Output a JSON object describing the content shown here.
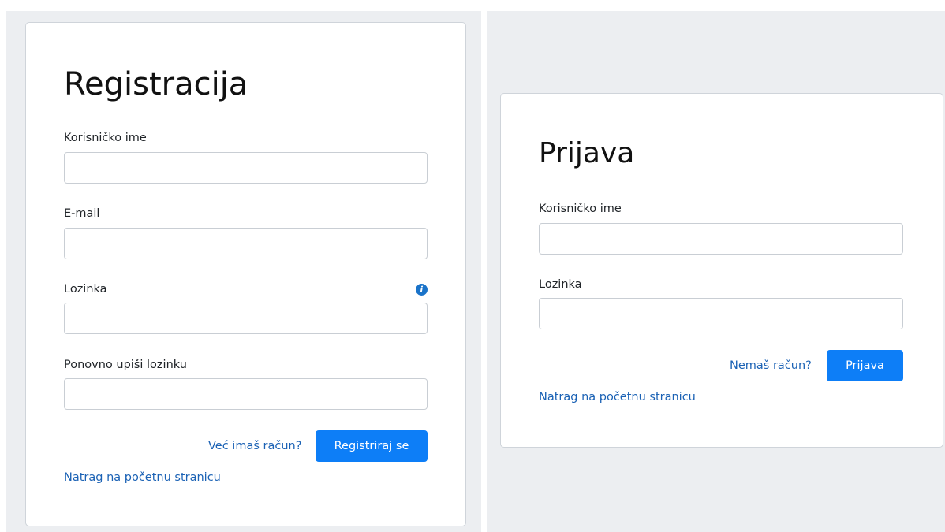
{
  "registration": {
    "title": "Registracija",
    "username_label": "Korisničko ime",
    "username_value": "",
    "email_label": "E-mail",
    "email_value": "",
    "password_label": "Lozinka",
    "password_info_icon": "info-circle-icon",
    "password_value": "",
    "repeat_password_label": "Ponovno upiši lozinku",
    "repeat_password_value": "",
    "login_link": "Već imaš račun?",
    "submit_label": "Registriraj se",
    "back_link": "Natrag na početnu stranicu"
  },
  "login": {
    "title": "Prijava",
    "username_label": "Korisničko ime",
    "username_value": "",
    "password_label": "Lozinka",
    "password_value": "",
    "register_link": "Nemaš račun?",
    "submit_label": "Prijava",
    "back_link": "Natrag na početnu stranicu"
  },
  "colors": {
    "primary": "#0d7ef7",
    "link": "#1b62b5",
    "panel_background": "#eceef1",
    "card_border": "#cfd4da",
    "info_icon": "#1a73c9"
  }
}
